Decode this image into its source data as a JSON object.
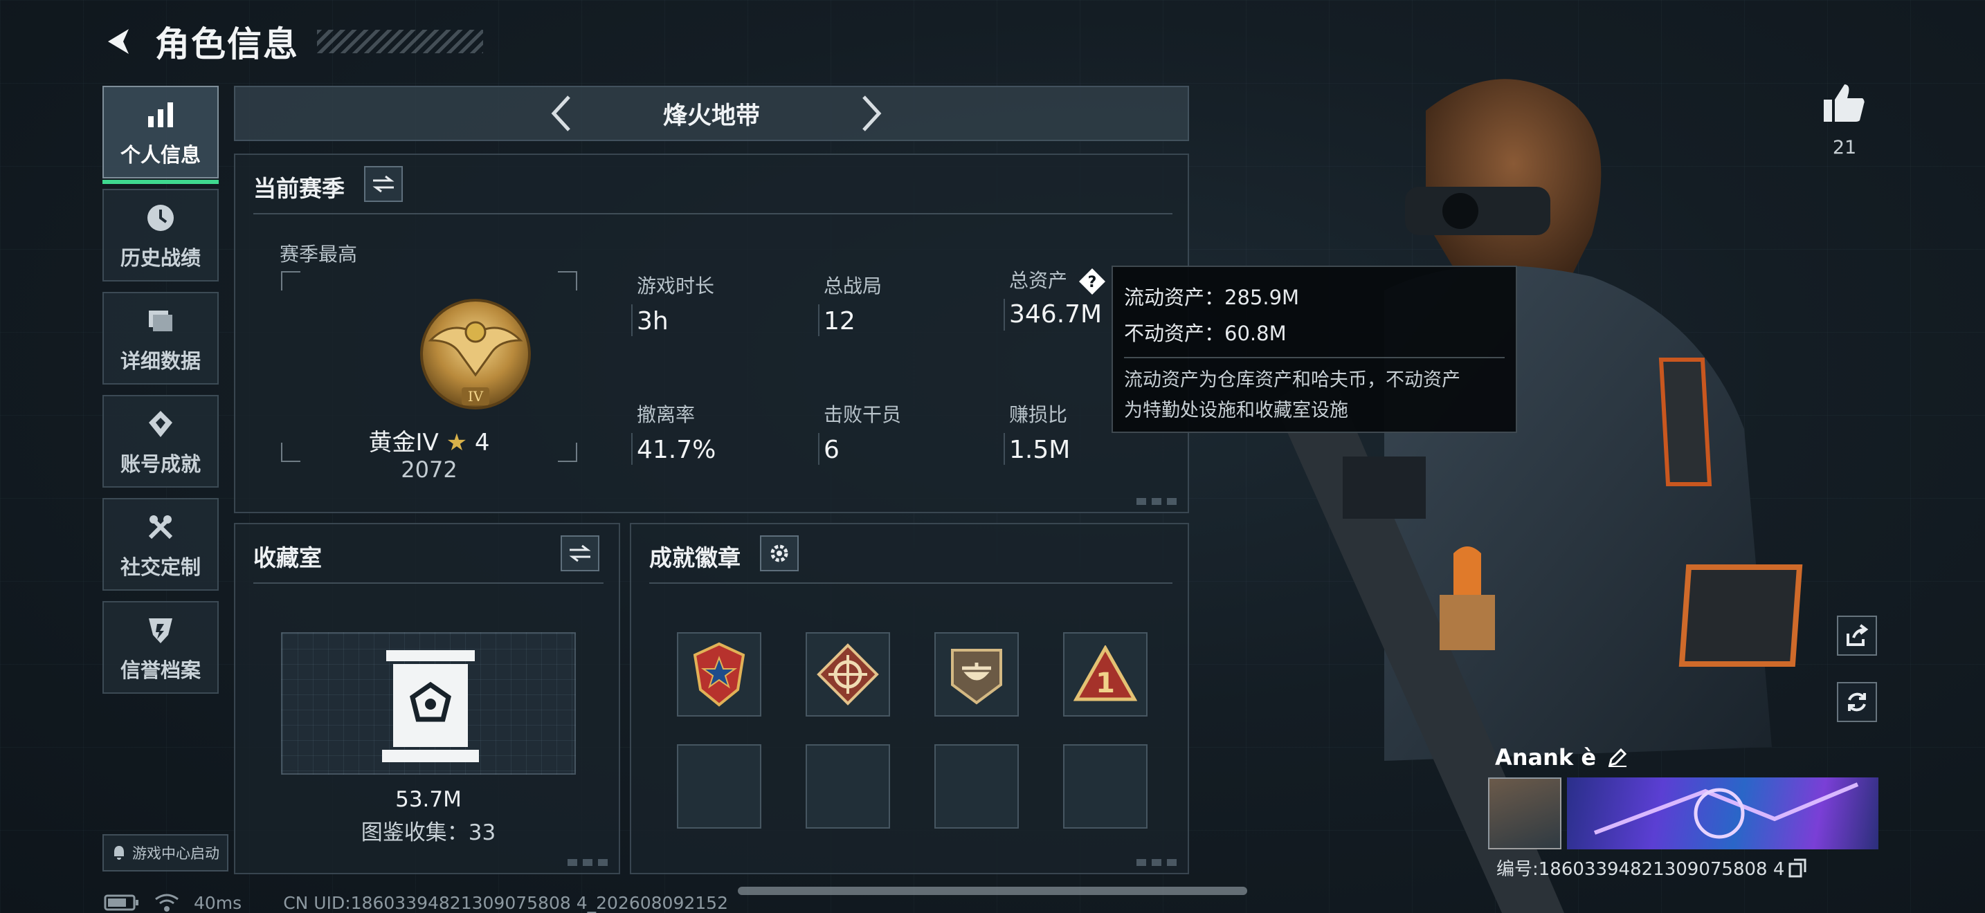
{
  "header": {
    "title": "角色信息"
  },
  "nav": {
    "items": [
      {
        "label": "个人信息",
        "icon": "bar-chart-icon",
        "active": true
      },
      {
        "label": "历史战绩",
        "icon": "history-icon"
      },
      {
        "label": "详细数据",
        "icon": "folder-icon"
      },
      {
        "label": "账号成就",
        "icon": "medal-icon"
      },
      {
        "label": "社交定制",
        "icon": "tools-icon"
      },
      {
        "label": "信誉档案",
        "icon": "shield-icon"
      }
    ],
    "launch_label": "游戏中心启动"
  },
  "mode": {
    "name": "烽火地带"
  },
  "season": {
    "title": "当前赛季",
    "best_label": "赛季最高",
    "rank_name": "黄金IV",
    "rank_star_icon": "star-icon",
    "rank_stars": "4",
    "rank_score": "2072",
    "stats": [
      {
        "label": "游戏时长",
        "value": "3h"
      },
      {
        "label": "总战局",
        "value": "12"
      },
      {
        "label": "总资产",
        "value": "346.7M"
      },
      {
        "label": "撤离率",
        "value": "41.7%"
      },
      {
        "label": "击败干员",
        "value": "6"
      },
      {
        "label": "赚损比",
        "value": "1.5M"
      }
    ]
  },
  "tooltip": {
    "liquid": "流动资产：285.9M",
    "fixed": "不动资产：60.8M",
    "note_line1": "流动资产为仓库资产和哈夫币，不动资产",
    "note_line2": "为特勤处设施和收藏室设施"
  },
  "collection": {
    "title": "收藏室",
    "value": "53.7M",
    "count": "图鉴收集：33"
  },
  "achievements": {
    "title": "成就徽章"
  },
  "profile": {
    "likes": "21",
    "name": "Anank è",
    "id": "编号:18603394821309075808 4"
  },
  "status": {
    "ping": "40ms",
    "uid": "CN UID:18603394821309075808 4_202608092152"
  },
  "colors": {
    "accent_green": "#3fd88f",
    "gold": "#d9b24a",
    "panel_bg": "#18222a"
  }
}
